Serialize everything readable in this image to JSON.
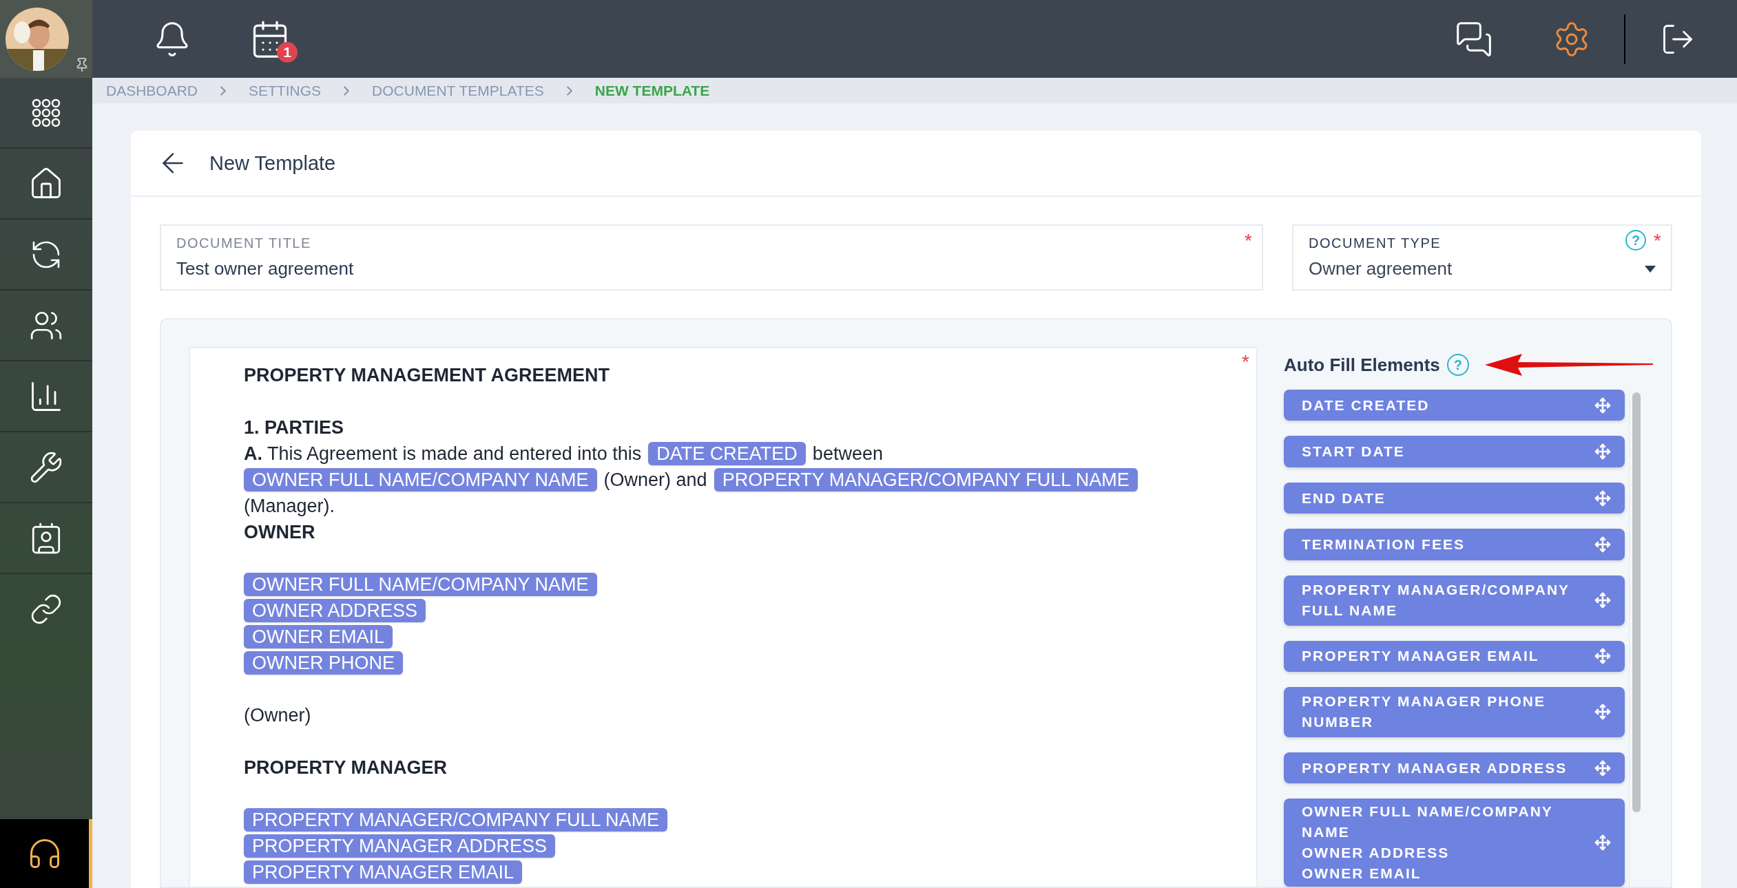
{
  "top_bar": {
    "calendar_badge": "1"
  },
  "breadcrumbs": [
    {
      "label": "DASHBOARD",
      "selected": false
    },
    {
      "label": "SETTINGS",
      "selected": false
    },
    {
      "label": "DOCUMENT TEMPLATES",
      "selected": false
    },
    {
      "label": "NEW TEMPLATE",
      "selected": true
    }
  ],
  "page": {
    "title": "New Template"
  },
  "fields": [
    {
      "kind": "text",
      "label": "DOCUMENT TITLE",
      "value": "Test owner agreement",
      "required_mark": "*"
    },
    {
      "kind": "select",
      "label": "DOCUMENT TYPE",
      "value": "Owner agreement",
      "help": "?",
      "required_mark": "*"
    }
  ],
  "editor": {
    "required_mark": "*",
    "paragraphs": [
      {
        "lines": [
          [
            {
              "kind": "bold",
              "text": "PROPERTY MANAGEMENT AGREEMENT"
            }
          ]
        ]
      },
      {
        "lines": [
          [
            {
              "kind": "bold",
              "text": "1. PARTIES"
            }
          ],
          [
            {
              "kind": "text",
              "text": "**A.** This Agreement is made and entered into this"
            },
            {
              "kind": "tag",
              "text": "DATE CREATED"
            },
            {
              "kind": "text",
              "text": "between"
            }
          ],
          [
            {
              "kind": "tag",
              "text": "OWNER FULL NAME/COMPANY NAME"
            },
            {
              "kind": "text",
              "text": "(Owner) and"
            },
            {
              "kind": "tag",
              "text": "PROPERTY MANAGER/COMPANY FULL NAME"
            }
          ],
          [
            {
              "kind": "text",
              "text": "(Manager)."
            }
          ],
          [
            {
              "kind": "bold",
              "text": "OWNER"
            }
          ]
        ]
      },
      {
        "lines": [
          [
            {
              "kind": "tag",
              "text": "OWNER FULL NAME/COMPANY NAME"
            }
          ],
          [
            {
              "kind": "tag",
              "text": "OWNER ADDRESS"
            }
          ],
          [
            {
              "kind": "tag",
              "text": "OWNER EMAIL"
            }
          ],
          [
            {
              "kind": "tag",
              "text": "OWNER PHONE"
            }
          ]
        ]
      },
      {
        "lines": [
          [
            {
              "kind": "text",
              "text": "(Owner)"
            }
          ]
        ]
      },
      {
        "lines": [
          [
            {
              "kind": "bold",
              "text": "PROPERTY MANAGER"
            }
          ]
        ]
      },
      {
        "lines": [
          [
            {
              "kind": "tag",
              "text": "PROPERTY MANAGER/COMPANY FULL NAME"
            }
          ],
          [
            {
              "kind": "tag",
              "text": "PROPERTY MANAGER ADDRESS"
            }
          ],
          [
            {
              "kind": "tag",
              "text": "PROPERTY MANAGER EMAIL"
            }
          ]
        ]
      }
    ]
  },
  "auto_fill": {
    "title": "Auto Fill Elements",
    "help": "?",
    "items": [
      {
        "label": "DATE CREATED"
      },
      {
        "label": "START DATE"
      },
      {
        "label": "END DATE"
      },
      {
        "label": "TERMINATION FEES"
      },
      {
        "label": "PROPERTY MANAGER/COMPANY FULL NAME"
      },
      {
        "label": "PROPERTY MANAGER EMAIL"
      },
      {
        "label": "PROPERTY MANAGER PHONE NUMBER"
      },
      {
        "label": "PROPERTY MANAGER ADDRESS"
      },
      {
        "label": "OWNER FULL NAME/COMPANY NAME\nOWNER ADDRESS\nOWNER EMAIL"
      }
    ]
  }
}
